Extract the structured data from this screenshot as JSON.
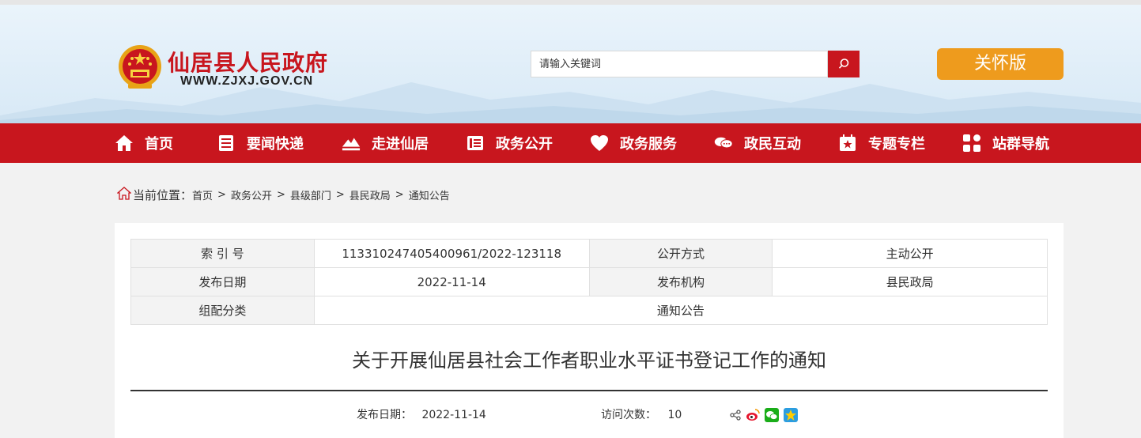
{
  "header": {
    "site_title": "仙居县人民政府",
    "site_url": "WWW.ZJXJ.GOV.CN",
    "search_placeholder": "请输入关键词",
    "care_label": "关怀版",
    "accent_color": "#c8161e",
    "care_color": "#ee9b1d"
  },
  "nav": {
    "items": [
      {
        "label": "首页",
        "icon": "home-icon"
      },
      {
        "label": "要闻快递",
        "icon": "news-icon"
      },
      {
        "label": "走进仙居",
        "icon": "landscape-icon"
      },
      {
        "label": "政务公开",
        "icon": "public-affairs-icon"
      },
      {
        "label": "政务服务",
        "icon": "heart-icon"
      },
      {
        "label": "政民互动",
        "icon": "chat-icon"
      },
      {
        "label": "专题专栏",
        "icon": "star-bookmark-icon"
      },
      {
        "label": "站群导航",
        "icon": "grid-icon"
      }
    ]
  },
  "breadcrumb": {
    "label": "当前位置：",
    "items": [
      "首页",
      "政务公开",
      "县级部门",
      "县民政局",
      "通知公告"
    ],
    "separator": ">"
  },
  "meta_table": {
    "index_label": "索 引 号",
    "index_value": "113310247405400961/2022-123118",
    "open_mode_label": "公开方式",
    "open_mode_value": "主动公开",
    "date_label": "发布日期",
    "date_value": "2022-11-14",
    "org_label": "发布机构",
    "org_value": "县民政局",
    "category_label": "组配分类",
    "category_value": "通知公告"
  },
  "article": {
    "title": "关于开展仙居县社会工作者职业水平证书登记工作的通知",
    "date_label": "发布日期：",
    "date_value": "2022-11-14",
    "views_label": "访问次数：",
    "views_value": "10",
    "share_icons": [
      "share-icon",
      "weibo-icon",
      "wechat-icon",
      "qzone-icon"
    ]
  }
}
